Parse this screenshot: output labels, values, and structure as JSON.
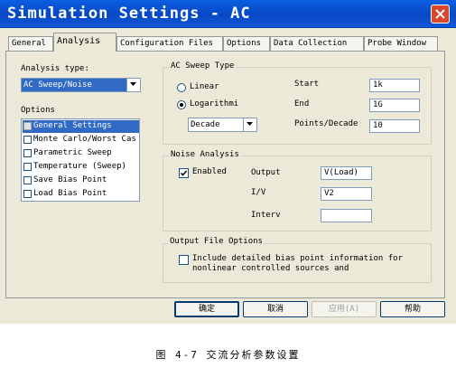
{
  "window": {
    "title": "Simulation Settings - AC"
  },
  "tabs": [
    {
      "label": "General"
    },
    {
      "label": "Analysis"
    },
    {
      "label": "Configuration Files"
    },
    {
      "label": "Options"
    },
    {
      "label": "Data Collection"
    },
    {
      "label": "Probe Window"
    }
  ],
  "analysis_type": {
    "label": "Analysis type:",
    "value": "AC Sweep/Noise"
  },
  "options": {
    "label": "Options",
    "items": [
      {
        "label": "General Settings",
        "checked": true
      },
      {
        "label": "Monte Carlo/Worst Cas",
        "checked": false
      },
      {
        "label": "Parametric Sweep",
        "checked": false
      },
      {
        "label": "Temperature (Sweep)",
        "checked": false
      },
      {
        "label": "Save Bias Point",
        "checked": false
      },
      {
        "label": "Load Bias Point",
        "checked": false
      }
    ]
  },
  "ac_sweep": {
    "group_title": "AC Sweep Type",
    "linear_label": "Linear",
    "log_label": "Logarithmi",
    "log_scale_value": "Decade",
    "start_label": "Start",
    "start_value": "1k",
    "end_label": "End",
    "end_value": "1G",
    "points_label": "Points/Decade",
    "points_value": "10"
  },
  "noise": {
    "group_title": "Noise Analysis",
    "enabled_label": "Enabled",
    "output_label": "Output",
    "output_value": "V(Load)",
    "iv_label": "I/V",
    "iv_value": "V2",
    "interval_label": "Interv",
    "interval_value": ""
  },
  "output_file": {
    "group_title": "Output File Options",
    "include_text_1": "Include detailed bias point information for",
    "include_text_2": "nonlinear controlled sources and"
  },
  "buttons": {
    "ok": "确定",
    "cancel": "取消",
    "apply": "应用(A)",
    "help": "帮助"
  },
  "caption": "图 4-7 交流分析参数设置",
  "colors": {
    "titlebar": "#0a5fe0",
    "selection": "#316ac5",
    "dialog_bg": "#ece9d8"
  }
}
